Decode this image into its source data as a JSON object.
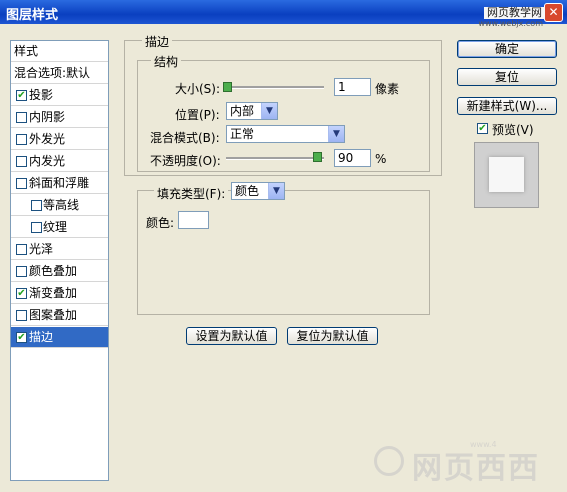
{
  "window": {
    "title": "图层样式",
    "close_glyph": "✕"
  },
  "watermark_top": {
    "line1": "网页教学网",
    "line2": "www.webjx.com"
  },
  "styles_panel": {
    "header": "样式",
    "items": [
      {
        "label": "混合选项:默认",
        "checkbox": false,
        "checked": false,
        "selected": false,
        "indent": false
      },
      {
        "label": "投影",
        "checkbox": true,
        "checked": true,
        "selected": false,
        "indent": false
      },
      {
        "label": "内阴影",
        "checkbox": true,
        "checked": false,
        "selected": false,
        "indent": false
      },
      {
        "label": "外发光",
        "checkbox": true,
        "checked": false,
        "selected": false,
        "indent": false
      },
      {
        "label": "内发光",
        "checkbox": true,
        "checked": false,
        "selected": false,
        "indent": false
      },
      {
        "label": "斜面和浮雕",
        "checkbox": true,
        "checked": false,
        "selected": false,
        "indent": false
      },
      {
        "label": "等高线",
        "checkbox": true,
        "checked": false,
        "selected": false,
        "indent": true
      },
      {
        "label": "纹理",
        "checkbox": true,
        "checked": false,
        "selected": false,
        "indent": true
      },
      {
        "label": "光泽",
        "checkbox": true,
        "checked": false,
        "selected": false,
        "indent": false
      },
      {
        "label": "颜色叠加",
        "checkbox": true,
        "checked": false,
        "selected": false,
        "indent": false
      },
      {
        "label": "渐变叠加",
        "checkbox": true,
        "checked": true,
        "selected": false,
        "indent": false
      },
      {
        "label": "图案叠加",
        "checkbox": true,
        "checked": false,
        "selected": false,
        "indent": false
      },
      {
        "label": "描边",
        "checkbox": true,
        "checked": true,
        "selected": true,
        "indent": false
      }
    ]
  },
  "stroke": {
    "group_title": "描边",
    "structure": {
      "title": "结构",
      "size_label": "大小(S):",
      "size_value": "1",
      "size_unit": "像素",
      "position_label": "位置(P):",
      "position_value": "内部",
      "blend_label": "混合模式(B):",
      "blend_value": "正常",
      "opacity_label": "不透明度(O):",
      "opacity_value": "90",
      "opacity_unit": "%"
    },
    "fill": {
      "type_label": "填充类型(F):",
      "type_value": "颜色",
      "color_label": "颜色:",
      "color_swatch": "#ffffff"
    },
    "set_default_button": "设置为默认值",
    "reset_default_button": "复位为默认值"
  },
  "buttons": {
    "ok": "确定",
    "reset": "复位",
    "new_style": "新建样式(W)...",
    "preview_label": "预览(V)",
    "preview_checked": true
  },
  "watermark_bottom": {
    "text": "网页西西",
    "small": "www.4"
  },
  "colors": {
    "titlebar": "#0a3fc0",
    "selection": "#316ac5",
    "checkmark": "#21a121"
  }
}
